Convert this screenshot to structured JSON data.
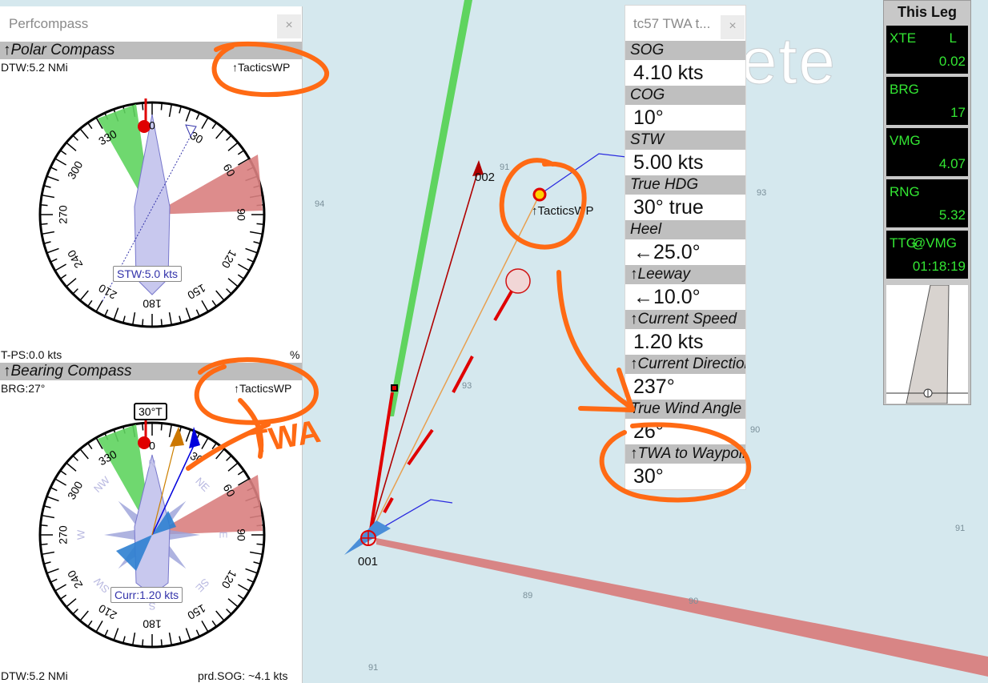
{
  "map": {
    "depths": [
      "94",
      "91",
      "93",
      "93",
      "90",
      "91",
      "89",
      "90",
      "91"
    ],
    "waypoints": {
      "wp1": "001",
      "wp2": "002",
      "tactics": "↑TacticsWP"
    },
    "bg_word": "ete",
    "colors": {
      "sea": "#d5e8ee",
      "route": "#cc0000",
      "laylines_green": "#5fd45f",
      "laylines_red": "#d98080",
      "annotation": "#ff6a14"
    }
  },
  "perfcompass": {
    "title": "Perfcompass",
    "close": "×",
    "polar": {
      "heading": "↑Polar Compass",
      "dtw": "DTW:5.2 NMi",
      "target": "↑TacticsWP",
      "stw_label": "STW:5.0 kts",
      "tps": "T-PS:0.0 kts",
      "pct": "%",
      "ticks": [
        "0",
        "30",
        "60",
        "90",
        "120",
        "150",
        "180",
        "210",
        "240",
        "270",
        "300",
        "330"
      ]
    },
    "bearing": {
      "heading": "↑Bearing Compass",
      "brg": "BRG:27°",
      "target": "↑TacticsWP",
      "twa_label": "30°T",
      "curr_label": "Curr:1.20 kts",
      "ticks": [
        "0",
        "30",
        "60",
        "90",
        "120",
        "150",
        "180",
        "210",
        "240",
        "270",
        "300",
        "330"
      ],
      "cardinals": [
        "NE",
        "E",
        "SE",
        "S",
        "SW",
        "W",
        "NW",
        "N"
      ],
      "dtw": "DTW:5.2 NMi",
      "prd_sog": "prd.SOG: ~4.1 kts"
    }
  },
  "twa_window": {
    "title": "tc57 TWA t...",
    "close": "×",
    "rows": [
      {
        "label": "SOG",
        "value": "4.10 kts"
      },
      {
        "label": "COG",
        "value": "10°"
      },
      {
        "label": "STW",
        "value": "5.00 kts"
      },
      {
        "label": "True HDG",
        "value": "30° true"
      },
      {
        "label": "Heel",
        "value": "←25.0°"
      },
      {
        "label": "↑Leeway",
        "value": "←10.0°"
      },
      {
        "label": "↑Current Speed",
        "value": "1.20 kts"
      },
      {
        "label": "↑Current Direction",
        "value": "237°"
      },
      {
        "label": "True Wind Angle",
        "value": "26°"
      },
      {
        "label": "↑TWA to Waypoint",
        "value": "30°"
      }
    ]
  },
  "this_leg": {
    "title": "This Leg",
    "items": [
      {
        "key": "XTE",
        "right": "L",
        "value": "0.02"
      },
      {
        "key": "BRG",
        "right": "",
        "value": "17"
      },
      {
        "key": "VMG",
        "right": "",
        "value": "4.07"
      },
      {
        "key": "RNG",
        "right": "",
        "value": "5.32"
      },
      {
        "key": "TTG",
        "right": "@VMG",
        "value": "01:18:19"
      }
    ]
  },
  "annotation": {
    "handwritten": "TWA"
  }
}
